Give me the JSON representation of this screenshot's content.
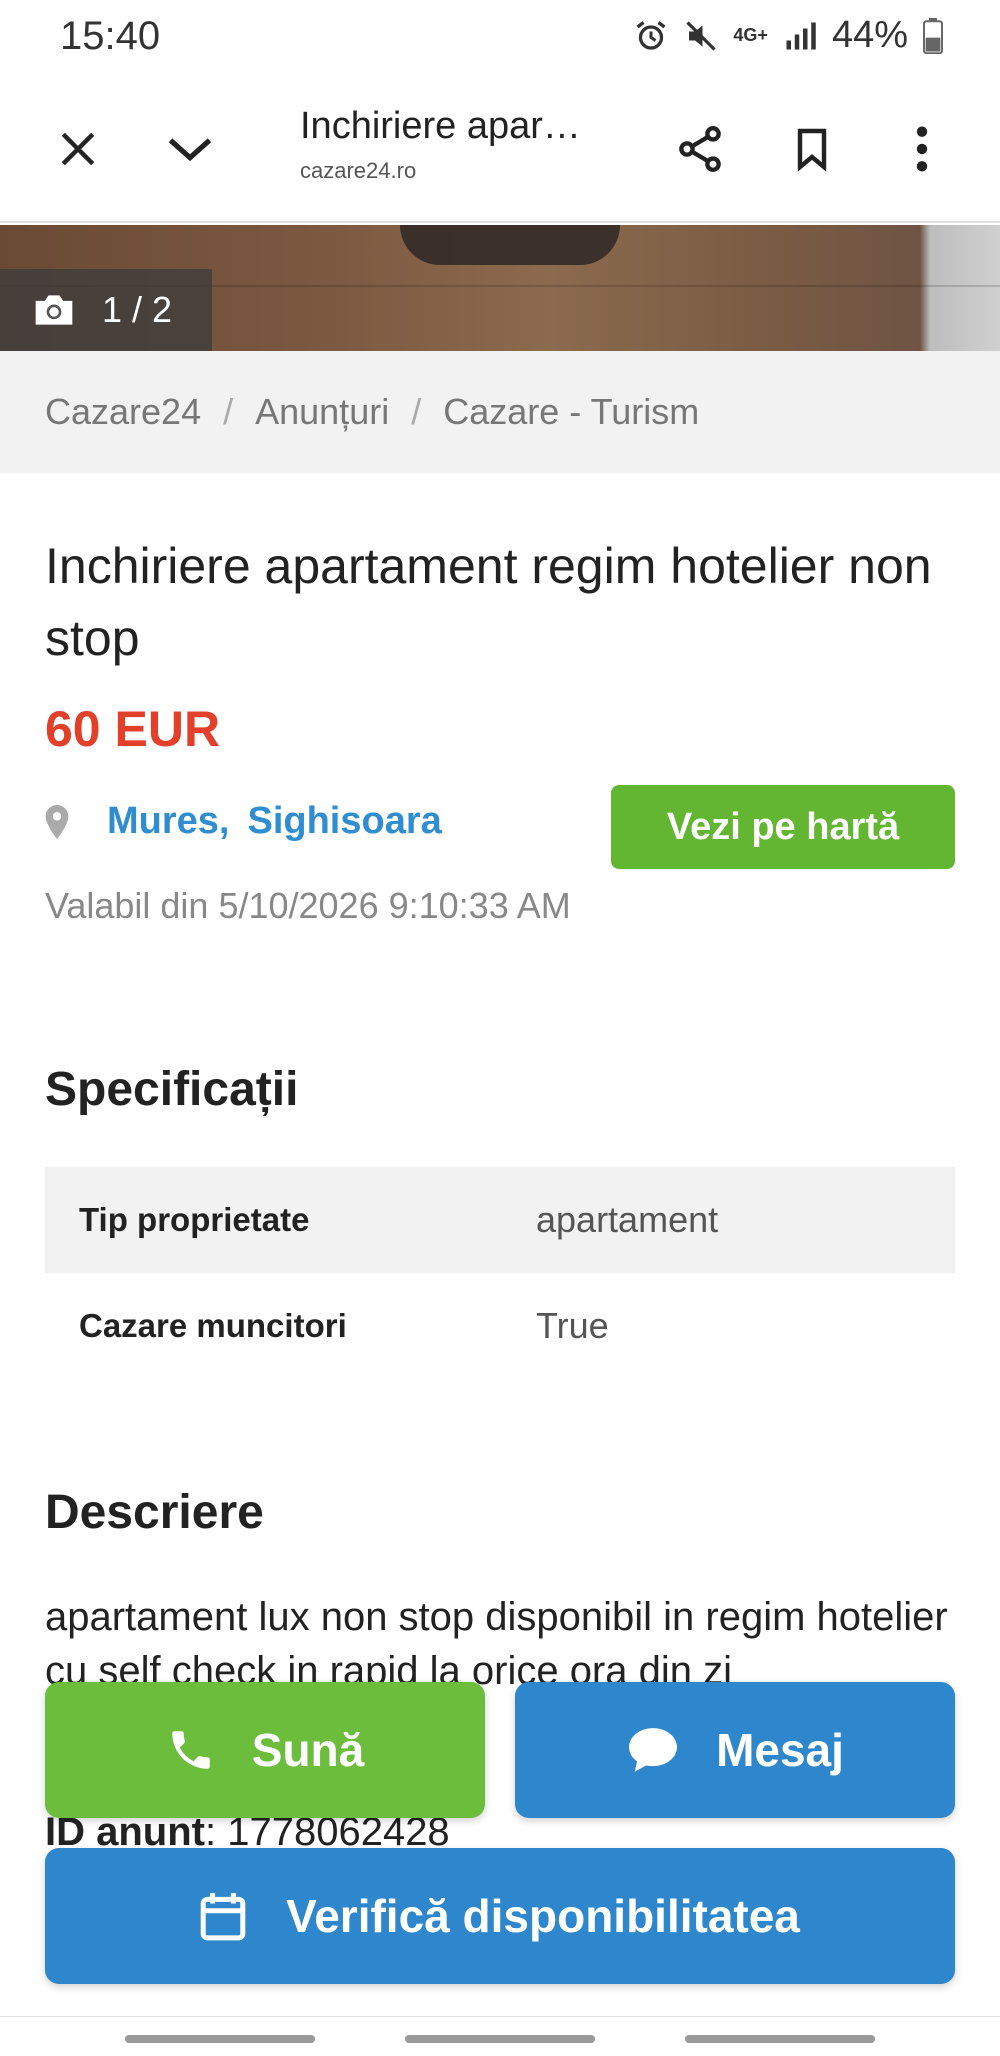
{
  "status": {
    "time": "15:40",
    "battery": "44%",
    "network": "4G+"
  },
  "browser": {
    "title": "Inchiriere apartament regim hotelier non stop",
    "url": "cazare24.ro",
    "icons": [
      "close-icon",
      "chevron-down-icon",
      "share-icon",
      "bookmark-icon",
      "more-vert-icon"
    ]
  },
  "gallery": {
    "counter": "1 / 2"
  },
  "breadcrumb": [
    "Cazare24",
    "Anunțuri",
    "Cazare - Turism"
  ],
  "listing": {
    "title": "Inchiriere apartament regim hotelier non stop",
    "price": "60 EUR",
    "county": "Mures",
    "city": "Sighisoara",
    "map_button": "Vezi pe hartă",
    "valid_from": "Valabil din 5/10/2026 9:10:33 AM"
  },
  "specs": {
    "heading": "Specificații",
    "rows": [
      {
        "key": "Tip proprietate",
        "value": "apartament"
      },
      {
        "key": "Cazare muncitori",
        "value": "True"
      }
    ]
  },
  "description": {
    "heading": "Descriere",
    "text": "apartament lux non stop disponibil in regim hotelier cu self check in rapid la orice ora din zi",
    "id_label": "ID anunt",
    "id_value": "1778062428"
  },
  "actions": {
    "call": "Sună",
    "message": "Mesaj",
    "check": "Verifică disponibilitatea"
  },
  "colors": {
    "price": "#e2402a",
    "green": "#6cbd3c",
    "blue": "#2e87cc",
    "link": "#2f8dd0"
  }
}
